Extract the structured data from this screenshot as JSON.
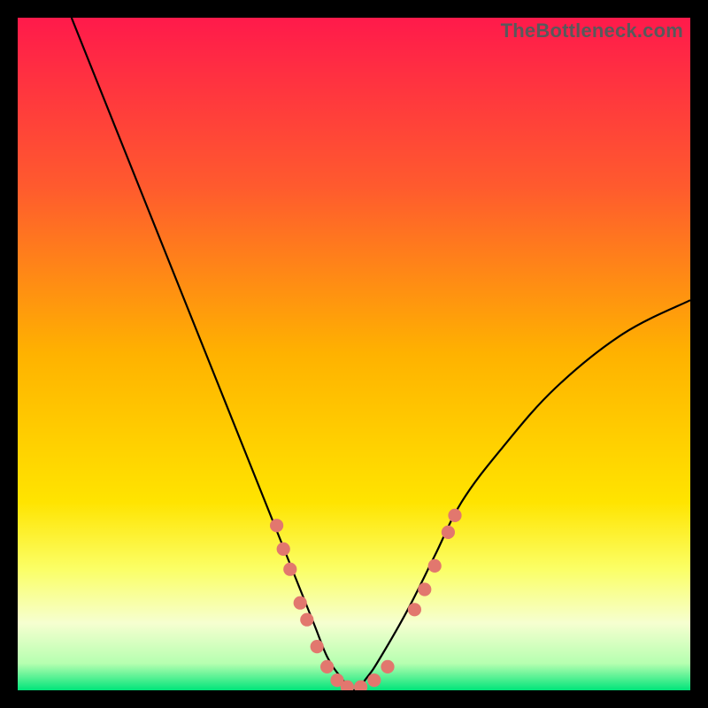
{
  "watermark": "TheBottleneck.com",
  "chart_data": {
    "type": "line",
    "title": "",
    "xlabel": "",
    "ylabel": "",
    "xlim": [
      0,
      100
    ],
    "ylim": [
      0,
      100
    ],
    "grid": false,
    "legend": false,
    "background_gradient": {
      "stops": [
        {
          "offset": 0.0,
          "color": "#ff1a4b"
        },
        {
          "offset": 0.25,
          "color": "#ff5a2e"
        },
        {
          "offset": 0.5,
          "color": "#ffb200"
        },
        {
          "offset": 0.72,
          "color": "#ffe400"
        },
        {
          "offset": 0.82,
          "color": "#fbff66"
        },
        {
          "offset": 0.9,
          "color": "#f6ffd0"
        },
        {
          "offset": 0.96,
          "color": "#b6ffb0"
        },
        {
          "offset": 1.0,
          "color": "#00e47a"
        }
      ]
    },
    "series": [
      {
        "name": "bottleneck-curve",
        "color": "#000000",
        "x": [
          8,
          12,
          16,
          20,
          24,
          28,
          32,
          36,
          40,
          44,
          46,
          48,
          50,
          52,
          54,
          58,
          62,
          66,
          72,
          80,
          90,
          100
        ],
        "y": [
          100,
          90,
          80,
          70,
          60,
          50,
          40,
          30,
          20,
          10,
          5,
          2,
          0,
          2,
          5,
          12,
          20,
          28,
          36,
          45,
          53,
          58
        ]
      }
    ],
    "markers": {
      "name": "highlight-points",
      "color": "#e2776e",
      "radius_pct": 1.0,
      "points": [
        {
          "x": 38.5,
          "y": 24.5
        },
        {
          "x": 39.5,
          "y": 21.0
        },
        {
          "x": 40.5,
          "y": 18.0
        },
        {
          "x": 42.0,
          "y": 13.0
        },
        {
          "x": 43.0,
          "y": 10.5
        },
        {
          "x": 44.5,
          "y": 6.5
        },
        {
          "x": 46.0,
          "y": 3.5
        },
        {
          "x": 47.5,
          "y": 1.5
        },
        {
          "x": 49.0,
          "y": 0.5
        },
        {
          "x": 51.0,
          "y": 0.5
        },
        {
          "x": 53.0,
          "y": 1.5
        },
        {
          "x": 55.0,
          "y": 3.5
        },
        {
          "x": 59.0,
          "y": 12.0
        },
        {
          "x": 60.5,
          "y": 15.0
        },
        {
          "x": 62.0,
          "y": 18.5
        },
        {
          "x": 64.0,
          "y": 23.5
        },
        {
          "x": 65.0,
          "y": 26.0
        }
      ]
    }
  }
}
